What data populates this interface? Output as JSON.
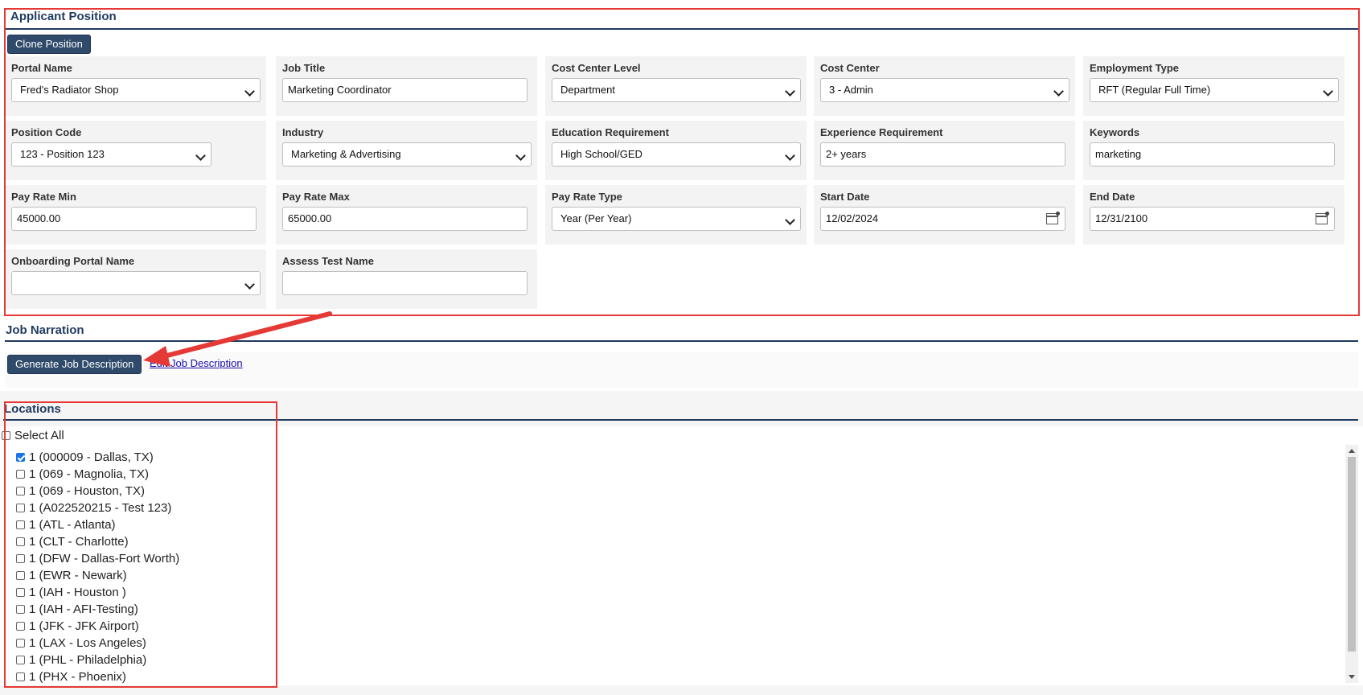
{
  "applicant_position": {
    "title": "Applicant Position",
    "clone_button": "Clone Position",
    "fields": {
      "portal_name": {
        "label": "Portal Name",
        "value": "Fred's Radiator Shop"
      },
      "job_title": {
        "label": "Job Title",
        "value": "Marketing Coordinator"
      },
      "cost_center_level": {
        "label": "Cost Center Level",
        "value": "Department"
      },
      "cost_center": {
        "label": "Cost Center",
        "value": "3 - Admin"
      },
      "employment_type": {
        "label": "Employment Type",
        "value": "RFT (Regular Full Time)"
      },
      "position_code": {
        "label": "Position Code",
        "value": "123 - Position 123"
      },
      "industry": {
        "label": "Industry",
        "value": "Marketing & Advertising"
      },
      "education_requirement": {
        "label": "Education Requirement",
        "value": "High School/GED"
      },
      "experience_requirement": {
        "label": "Experience Requirement",
        "value": "2+ years"
      },
      "keywords": {
        "label": "Keywords",
        "value": "marketing"
      },
      "pay_rate_min": {
        "label": "Pay Rate Min",
        "value": "45000.00"
      },
      "pay_rate_max": {
        "label": "Pay Rate Max",
        "value": "65000.00"
      },
      "pay_rate_type": {
        "label": "Pay Rate Type",
        "value": "Year (Per Year)"
      },
      "start_date": {
        "label": "Start Date",
        "value": "12/02/2024"
      },
      "end_date": {
        "label": "End Date",
        "value": "12/31/2100"
      },
      "onboarding_portal_name": {
        "label": "Onboarding Portal Name",
        "value": ""
      },
      "assess_test_name": {
        "label": "Assess Test Name",
        "value": ""
      }
    }
  },
  "job_narration": {
    "title": "Job Narration",
    "generate_button": "Generate Job Description",
    "edit_link": "Edit Job Description"
  },
  "locations": {
    "title": "Locations",
    "select_all": "Select All",
    "select_all_checked": false,
    "items": [
      {
        "label": "1 (000009 - Dallas, TX)",
        "checked": true
      },
      {
        "label": "1 (069 - Magnolia, TX)",
        "checked": false
      },
      {
        "label": "1 (069 - Houston, TX)",
        "checked": false
      },
      {
        "label": "1 (A022520215 - Test 123)",
        "checked": false
      },
      {
        "label": "1 (ATL - Atlanta)",
        "checked": false
      },
      {
        "label": "1 (CLT - Charlotte)",
        "checked": false
      },
      {
        "label": "1 (DFW - Dallas-Fort Worth)",
        "checked": false
      },
      {
        "label": "1 (EWR - Newark)",
        "checked": false
      },
      {
        "label": "1 (IAH - Houston )",
        "checked": false
      },
      {
        "label": "1 (IAH - AFI-Testing)",
        "checked": false
      },
      {
        "label": "1 (JFK - JFK Airport)",
        "checked": false
      },
      {
        "label": "1 (LAX - Los Angeles)",
        "checked": false
      },
      {
        "label": "1 (PHL - Philadelphia)",
        "checked": false
      },
      {
        "label": "1 (PHX - Phoenix)",
        "checked": false
      }
    ]
  },
  "icons": [
    "calendar-icon",
    "chevron-down-icon",
    "checkbox-icon"
  ],
  "colors": {
    "accent": "#2f4a6b",
    "heading": "#1f3a5f",
    "annotation": "#e53935",
    "cell_bg": "#f3f3f3"
  }
}
